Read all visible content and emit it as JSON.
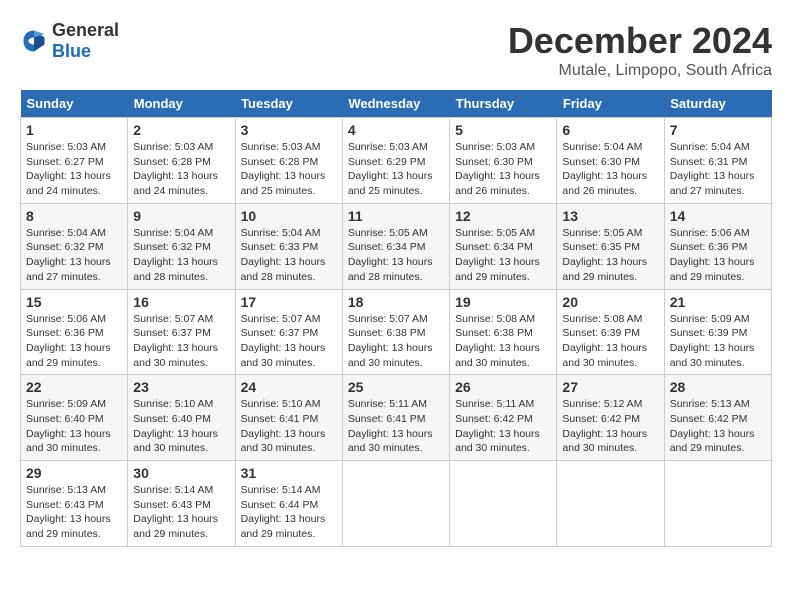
{
  "logo": {
    "general": "General",
    "blue": "Blue"
  },
  "title": "December 2024",
  "location": "Mutale, Limpopo, South Africa",
  "weekdays": [
    "Sunday",
    "Monday",
    "Tuesday",
    "Wednesday",
    "Thursday",
    "Friday",
    "Saturday"
  ],
  "weeks": [
    [
      {
        "day": "1",
        "sunrise": "5:03 AM",
        "sunset": "6:27 PM",
        "daylight": "13 hours and 24 minutes."
      },
      {
        "day": "2",
        "sunrise": "5:03 AM",
        "sunset": "6:28 PM",
        "daylight": "13 hours and 24 minutes."
      },
      {
        "day": "3",
        "sunrise": "5:03 AM",
        "sunset": "6:28 PM",
        "daylight": "13 hours and 25 minutes."
      },
      {
        "day": "4",
        "sunrise": "5:03 AM",
        "sunset": "6:29 PM",
        "daylight": "13 hours and 25 minutes."
      },
      {
        "day": "5",
        "sunrise": "5:03 AM",
        "sunset": "6:30 PM",
        "daylight": "13 hours and 26 minutes."
      },
      {
        "day": "6",
        "sunrise": "5:04 AM",
        "sunset": "6:30 PM",
        "daylight": "13 hours and 26 minutes."
      },
      {
        "day": "7",
        "sunrise": "5:04 AM",
        "sunset": "6:31 PM",
        "daylight": "13 hours and 27 minutes."
      }
    ],
    [
      {
        "day": "8",
        "sunrise": "5:04 AM",
        "sunset": "6:32 PM",
        "daylight": "13 hours and 27 minutes."
      },
      {
        "day": "9",
        "sunrise": "5:04 AM",
        "sunset": "6:32 PM",
        "daylight": "13 hours and 28 minutes."
      },
      {
        "day": "10",
        "sunrise": "5:04 AM",
        "sunset": "6:33 PM",
        "daylight": "13 hours and 28 minutes."
      },
      {
        "day": "11",
        "sunrise": "5:05 AM",
        "sunset": "6:34 PM",
        "daylight": "13 hours and 28 minutes."
      },
      {
        "day": "12",
        "sunrise": "5:05 AM",
        "sunset": "6:34 PM",
        "daylight": "13 hours and 29 minutes."
      },
      {
        "day": "13",
        "sunrise": "5:05 AM",
        "sunset": "6:35 PM",
        "daylight": "13 hours and 29 minutes."
      },
      {
        "day": "14",
        "sunrise": "5:06 AM",
        "sunset": "6:36 PM",
        "daylight": "13 hours and 29 minutes."
      }
    ],
    [
      {
        "day": "15",
        "sunrise": "5:06 AM",
        "sunset": "6:36 PM",
        "daylight": "13 hours and 29 minutes."
      },
      {
        "day": "16",
        "sunrise": "5:07 AM",
        "sunset": "6:37 PM",
        "daylight": "13 hours and 30 minutes."
      },
      {
        "day": "17",
        "sunrise": "5:07 AM",
        "sunset": "6:37 PM",
        "daylight": "13 hours and 30 minutes."
      },
      {
        "day": "18",
        "sunrise": "5:07 AM",
        "sunset": "6:38 PM",
        "daylight": "13 hours and 30 minutes."
      },
      {
        "day": "19",
        "sunrise": "5:08 AM",
        "sunset": "6:38 PM",
        "daylight": "13 hours and 30 minutes."
      },
      {
        "day": "20",
        "sunrise": "5:08 AM",
        "sunset": "6:39 PM",
        "daylight": "13 hours and 30 minutes."
      },
      {
        "day": "21",
        "sunrise": "5:09 AM",
        "sunset": "6:39 PM",
        "daylight": "13 hours and 30 minutes."
      }
    ],
    [
      {
        "day": "22",
        "sunrise": "5:09 AM",
        "sunset": "6:40 PM",
        "daylight": "13 hours and 30 minutes."
      },
      {
        "day": "23",
        "sunrise": "5:10 AM",
        "sunset": "6:40 PM",
        "daylight": "13 hours and 30 minutes."
      },
      {
        "day": "24",
        "sunrise": "5:10 AM",
        "sunset": "6:41 PM",
        "daylight": "13 hours and 30 minutes."
      },
      {
        "day": "25",
        "sunrise": "5:11 AM",
        "sunset": "6:41 PM",
        "daylight": "13 hours and 30 minutes."
      },
      {
        "day": "26",
        "sunrise": "5:11 AM",
        "sunset": "6:42 PM",
        "daylight": "13 hours and 30 minutes."
      },
      {
        "day": "27",
        "sunrise": "5:12 AM",
        "sunset": "6:42 PM",
        "daylight": "13 hours and 30 minutes."
      },
      {
        "day": "28",
        "sunrise": "5:13 AM",
        "sunset": "6:42 PM",
        "daylight": "13 hours and 29 minutes."
      }
    ],
    [
      {
        "day": "29",
        "sunrise": "5:13 AM",
        "sunset": "6:43 PM",
        "daylight": "13 hours and 29 minutes."
      },
      {
        "day": "30",
        "sunrise": "5:14 AM",
        "sunset": "6:43 PM",
        "daylight": "13 hours and 29 minutes."
      },
      {
        "day": "31",
        "sunrise": "5:14 AM",
        "sunset": "6:44 PM",
        "daylight": "13 hours and 29 minutes."
      },
      null,
      null,
      null,
      null
    ]
  ]
}
